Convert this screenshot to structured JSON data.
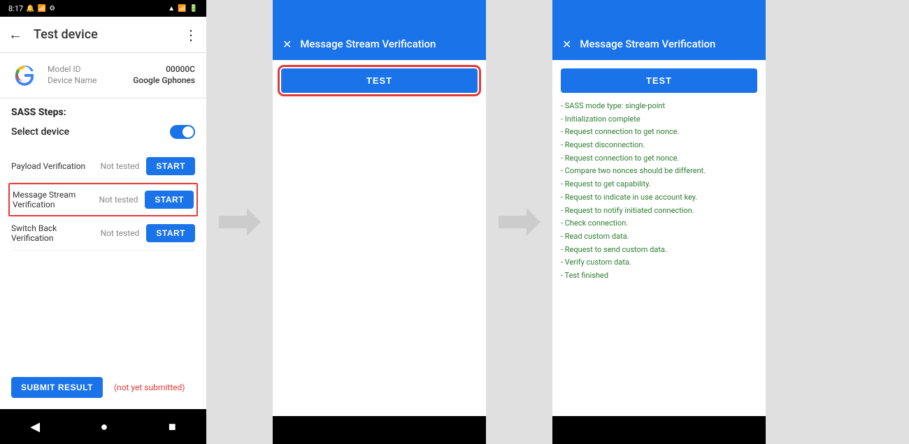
{
  "phone": {
    "status_bar": {
      "time": "8:17",
      "icons": [
        "notification",
        "sim",
        "settings",
        "signal",
        "wifi",
        "battery"
      ]
    },
    "toolbar": {
      "title": "Test device",
      "back_label": "←",
      "more_label": "⋮"
    },
    "device_info": {
      "model_id_label": "Model ID",
      "model_id_value": "00000C",
      "device_name_label": "Device Name",
      "device_name_value": "Google Gphones"
    },
    "sass": {
      "section_title": "SASS Steps:",
      "select_device_label": "Select device",
      "rows": [
        {
          "label": "Payload Verification",
          "status": "Not tested",
          "button": "START"
        },
        {
          "label": "Message Stream Verification",
          "status": "Not tested",
          "button": "START",
          "highlighted": true
        },
        {
          "label": "Switch Back Verification",
          "status": "Not tested",
          "button": "START"
        }
      ],
      "submit_button": "SUBMIT RESULT",
      "submit_status": "(not yet submitted)"
    },
    "nav": {
      "back": "◀",
      "home": "●",
      "recents": "■"
    }
  },
  "dialog_initial": {
    "header_title": "Message Stream Verification",
    "close_icon": "✕",
    "test_button": "TEST"
  },
  "dialog_completed": {
    "header_title": "Message Stream Verification",
    "close_icon": "✕",
    "test_button": "TEST",
    "result_lines": [
      "- SASS mode type: single-point",
      "- Initialization complete",
      "- Request connection to get nonce.",
      "- Request disconnection.",
      "- Request connection to get nonce.",
      "- Compare two nonces should be different.",
      "- Request to get capability.",
      "- Request to indicate in use account key.",
      "- Request to notify initiated connection.",
      "- Check connection.",
      "- Read custom data.",
      "- Request to send custom data.",
      "- Verify custom data.",
      "- Test finished"
    ]
  },
  "colors": {
    "blue": "#1a73e8",
    "red_highlight": "#e53935",
    "green_text": "#2e7d32"
  }
}
